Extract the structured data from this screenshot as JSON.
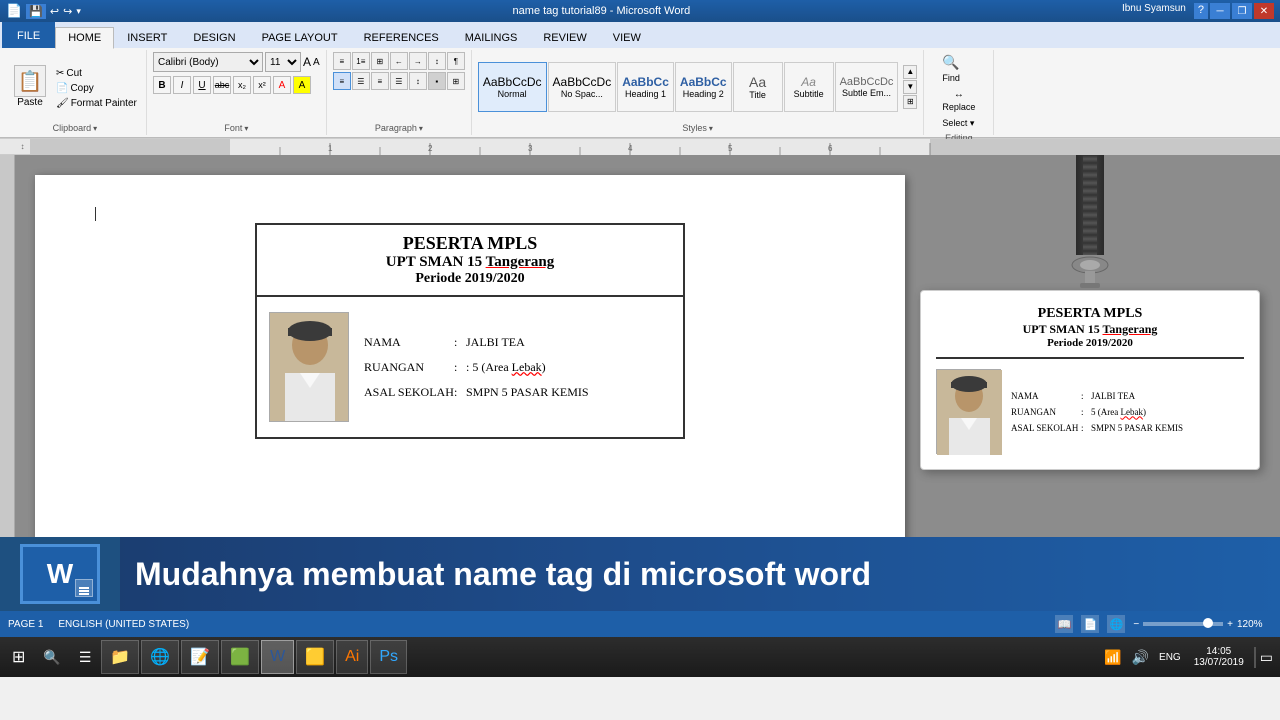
{
  "titlebar": {
    "title": "name tag tutorial89 - Microsoft Word",
    "help_icon": "?",
    "min_icon": "─",
    "restore_icon": "❐",
    "close_icon": "✕"
  },
  "ribbon": {
    "tabs": [
      "FILE",
      "HOME",
      "INSERT",
      "DESIGN",
      "PAGE LAYOUT",
      "REFERENCES",
      "MAILINGS",
      "REVIEW",
      "VIEW"
    ],
    "active_tab": "HOME",
    "clipboard": {
      "paste_label": "Paste",
      "cut_label": "Cut",
      "copy_label": "Copy",
      "format_painter_label": "Format Painter",
      "group_label": "Clipboard"
    },
    "font": {
      "font_name": "Calibri (Body)",
      "font_size": "11",
      "group_label": "Font",
      "bold": "B",
      "italic": "I",
      "underline": "U",
      "strikethrough": "abc",
      "subscript": "x₂",
      "superscript": "x²"
    },
    "paragraph": {
      "group_label": "Paragraph"
    },
    "styles": {
      "group_label": "Styles",
      "items": [
        {
          "label": "Normal",
          "preview": "AaBbCcDc"
        },
        {
          "label": "No Spac...",
          "preview": "AaBbCcDc"
        },
        {
          "label": "Heading 1",
          "preview": "AaBbCc"
        },
        {
          "label": "Heading 2",
          "preview": "AaBbCc"
        },
        {
          "label": "Title",
          "preview": "Aa"
        },
        {
          "label": "Subtitle",
          "preview": "Aa"
        },
        {
          "label": "Subtle Em...",
          "preview": "AaBbCcDc"
        }
      ]
    },
    "editing": {
      "find_label": "Find",
      "replace_label": "Replace",
      "select_label": "Select ▾",
      "group_label": "Editing"
    }
  },
  "document": {
    "name_tag": {
      "header_line1": "PESERTA MPLS",
      "header_line2": "UPT SMAN 15 Tangerang",
      "header_line3": "Periode 2019/2020",
      "fields": [
        {
          "label": "NAMA",
          "colon": ":",
          "value": "JALBI TEA"
        },
        {
          "label": "RUANGAN",
          "colon": ":",
          "value": "5 (Area Lebak)"
        },
        {
          "label": "ASAL SEKOLAH",
          "colon": ":",
          "value": "SMPN 5 PASAR KEMIS"
        }
      ]
    }
  },
  "badge_preview": {
    "header_line1": "PESERTA MPLS",
    "header_line2": "UPT SMAN 15 Tangerang",
    "header_line3": "Periode 2019/2020",
    "fields": [
      {
        "label": "NAMA",
        "colon": ":",
        "value": "JALBI TEA"
      },
      {
        "label": "RUANGAN",
        "colon": ":",
        "value": "5 (Area Lebak)"
      },
      {
        "label": "ASAL SEKOLAH",
        "colon": ":",
        "value": "SMPN 5 PASAR KEMIS"
      }
    ]
  },
  "video_banner": {
    "text": "Mudahnya membuat name tag di microsoft word"
  },
  "status_bar": {
    "page": "PAGE 1",
    "language": "ENGLISH (UNITED STATES)",
    "zoom": "120%"
  },
  "taskbar": {
    "time": "14:05",
    "date": "13/07/2019",
    "language": "ENG",
    "buttons": [
      "⊞",
      "🔍",
      "☰",
      "📁",
      "🌐",
      "📝",
      "🟩",
      "W",
      "🟨",
      "🎨",
      "🖼"
    ]
  },
  "user": {
    "name": "Ibnu Syamsun"
  }
}
